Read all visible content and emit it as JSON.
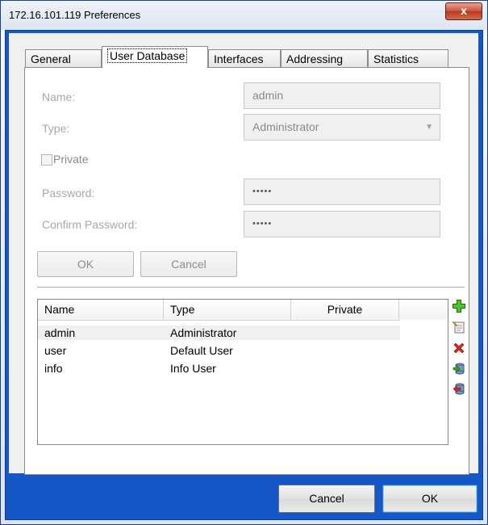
{
  "window": {
    "title": "172.16.101.119 Preferences",
    "close_glyph": "x"
  },
  "tabs": [
    {
      "label": "General",
      "active": false
    },
    {
      "label": "User Database",
      "active": true
    },
    {
      "label": "Interfaces",
      "active": false
    },
    {
      "label": "Addressing",
      "active": false
    },
    {
      "label": "Statistics",
      "active": false
    }
  ],
  "form": {
    "name_label": "Name:",
    "name_value": "admin",
    "type_label": "Type:",
    "type_value": "Administrator",
    "private_label": "Private",
    "private_checked": false,
    "password_label": "Password:",
    "password_value": "•••••",
    "confirm_label": "Confirm Password:",
    "confirm_value": "•••••",
    "ok_label": "OK",
    "cancel_label": "Cancel"
  },
  "user_list": {
    "columns": [
      "Name",
      "Type",
      "Private"
    ],
    "rows": [
      {
        "name": "admin",
        "type": "Administrator",
        "private": ""
      },
      {
        "name": "user",
        "type": "Default User",
        "private": ""
      },
      {
        "name": "info",
        "type": "Info User",
        "private": ""
      }
    ],
    "selected_row": 0
  },
  "side_toolbar": [
    "add-user-icon",
    "edit-user-icon",
    "delete-user-icon",
    "import-users-icon",
    "export-users-icon"
  ],
  "dialog_buttons": {
    "cancel": "Cancel",
    "ok": "OK"
  },
  "colors": {
    "frame_blue": "#1657c8",
    "close_red": "#c8523a",
    "disabled_text": "#a8a8a8"
  }
}
